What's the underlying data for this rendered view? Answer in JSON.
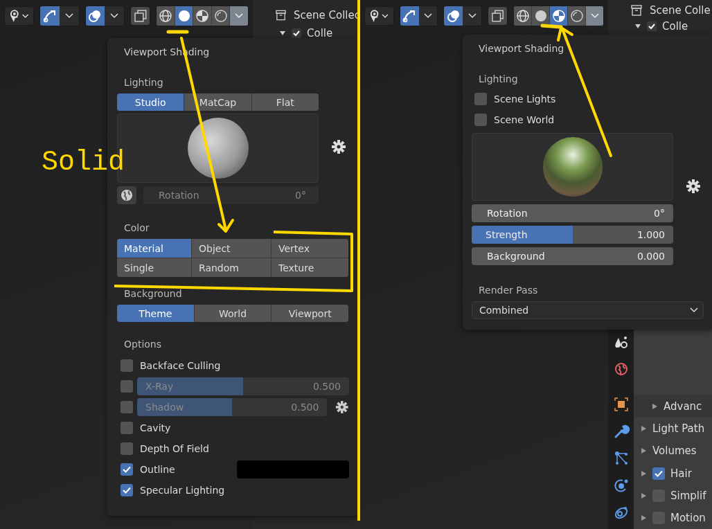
{
  "left": {
    "toolbar": {
      "shading_modes": [
        {
          "selected": false
        },
        {
          "selected": true
        },
        {
          "selected": false
        },
        {
          "selected": false
        }
      ]
    },
    "outliner": {
      "header": "Scene Collec",
      "row": "Colle",
      "checked": true
    },
    "annotation": "Solid",
    "popup": {
      "title": "Viewport Shading",
      "lighting_label": "Lighting",
      "lighting_modes": [
        {
          "label": "Studio",
          "selected": true
        },
        {
          "label": "MatCap",
          "selected": false
        },
        {
          "label": "Flat",
          "selected": false
        }
      ],
      "rotation": {
        "label": "Rotation",
        "value": "0°",
        "disabled": true
      },
      "color_label": "Color",
      "color_modes": [
        {
          "label": "Material",
          "selected": true
        },
        {
          "label": "Object",
          "selected": false
        },
        {
          "label": "Vertex",
          "selected": false
        },
        {
          "label": "Single",
          "selected": false
        },
        {
          "label": "Random",
          "selected": false
        },
        {
          "label": "Texture",
          "selected": false
        }
      ],
      "background_label": "Background",
      "background_modes": [
        {
          "label": "Theme",
          "selected": true
        },
        {
          "label": "World",
          "selected": false
        },
        {
          "label": "Viewport",
          "selected": false
        }
      ],
      "options_label": "Options",
      "options": [
        {
          "kind": "checkbox",
          "label": "Backface Culling",
          "checked": false
        },
        {
          "kind": "slider",
          "label": "X-Ray",
          "value": "0.500",
          "level": 0.5,
          "checked": false,
          "disabled": true
        },
        {
          "kind": "slider_gear",
          "label": "Shadow",
          "value": "0.500",
          "level": 0.5,
          "checked": false,
          "disabled": true
        },
        {
          "kind": "checkbox",
          "label": "Cavity",
          "checked": false
        },
        {
          "kind": "checkbox",
          "label": "Depth Of Field",
          "checked": false
        },
        {
          "kind": "color",
          "label": "Outline",
          "checked": true
        },
        {
          "kind": "checkbox",
          "label": "Specular Lighting",
          "checked": true
        }
      ]
    }
  },
  "right": {
    "toolbar": {
      "shading_modes": [
        {
          "selected": false
        },
        {
          "selected": false
        },
        {
          "selected": true
        },
        {
          "selected": false
        }
      ]
    },
    "outliner": {
      "header": "Scene Colle",
      "row": "Colle",
      "checked": true
    },
    "popup": {
      "title": "Viewport Shading",
      "lighting_label": "Lighting",
      "lighting_checks": [
        {
          "label": "Scene Lights",
          "checked": false
        },
        {
          "label": "Scene World",
          "checked": false
        }
      ],
      "sliders": [
        {
          "kind": "number",
          "label": "Rotation",
          "value": "0°"
        },
        {
          "kind": "slider",
          "label": "Strength",
          "value": "1.000",
          "level": 0.5
        },
        {
          "kind": "number",
          "label": "Background",
          "value": "0.000"
        }
      ],
      "render_pass_label": "Render Pass",
      "render_pass": "Combined"
    },
    "properties": {
      "rows": [
        {
          "kind": "sub",
          "label": "Advanc"
        },
        {
          "kind": "panel",
          "label": "Light Path"
        },
        {
          "kind": "panel",
          "label": "Volumes"
        },
        {
          "kind": "check",
          "label": "Hair",
          "checked": true
        },
        {
          "kind": "check",
          "label": "Simplif",
          "checked": false
        },
        {
          "kind": "check",
          "label": "Motion",
          "checked": false
        }
      ]
    }
  }
}
